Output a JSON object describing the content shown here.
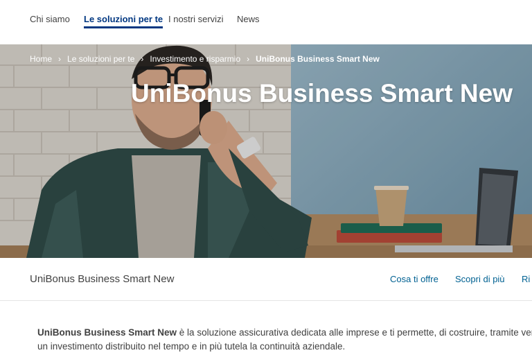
{
  "topnav": {
    "items": [
      {
        "label": "Chi siamo"
      },
      {
        "label": "Le soluzioni per te",
        "active": true
      },
      {
        "label": "I nostri servizi"
      },
      {
        "label": "News"
      }
    ]
  },
  "hero": {
    "breadcrumb": [
      "Home",
      "Le soluzioni per te",
      "Investimento e risparmio",
      "UniBonus Business Smart New"
    ],
    "separator_icon": "chevron-right-icon",
    "title": "UniBonus Business Smart New"
  },
  "subbar": {
    "product_name": "UniBonus Business Smart New",
    "links": [
      "Cosa ti offre",
      "Scopri di più",
      "Ri"
    ]
  },
  "intro": {
    "bold": "UniBonus Business Smart New",
    "line1_rest": " è la soluzione assicurativa dedicata alle imprese e ti permette, di costruire, tramite ver",
    "line2": "un investimento distribuito nel tempo e in più tutela la continuità aziendale."
  },
  "colors": {
    "brand_blue": "#003781",
    "link_blue": "#006192",
    "text": "#414141"
  }
}
